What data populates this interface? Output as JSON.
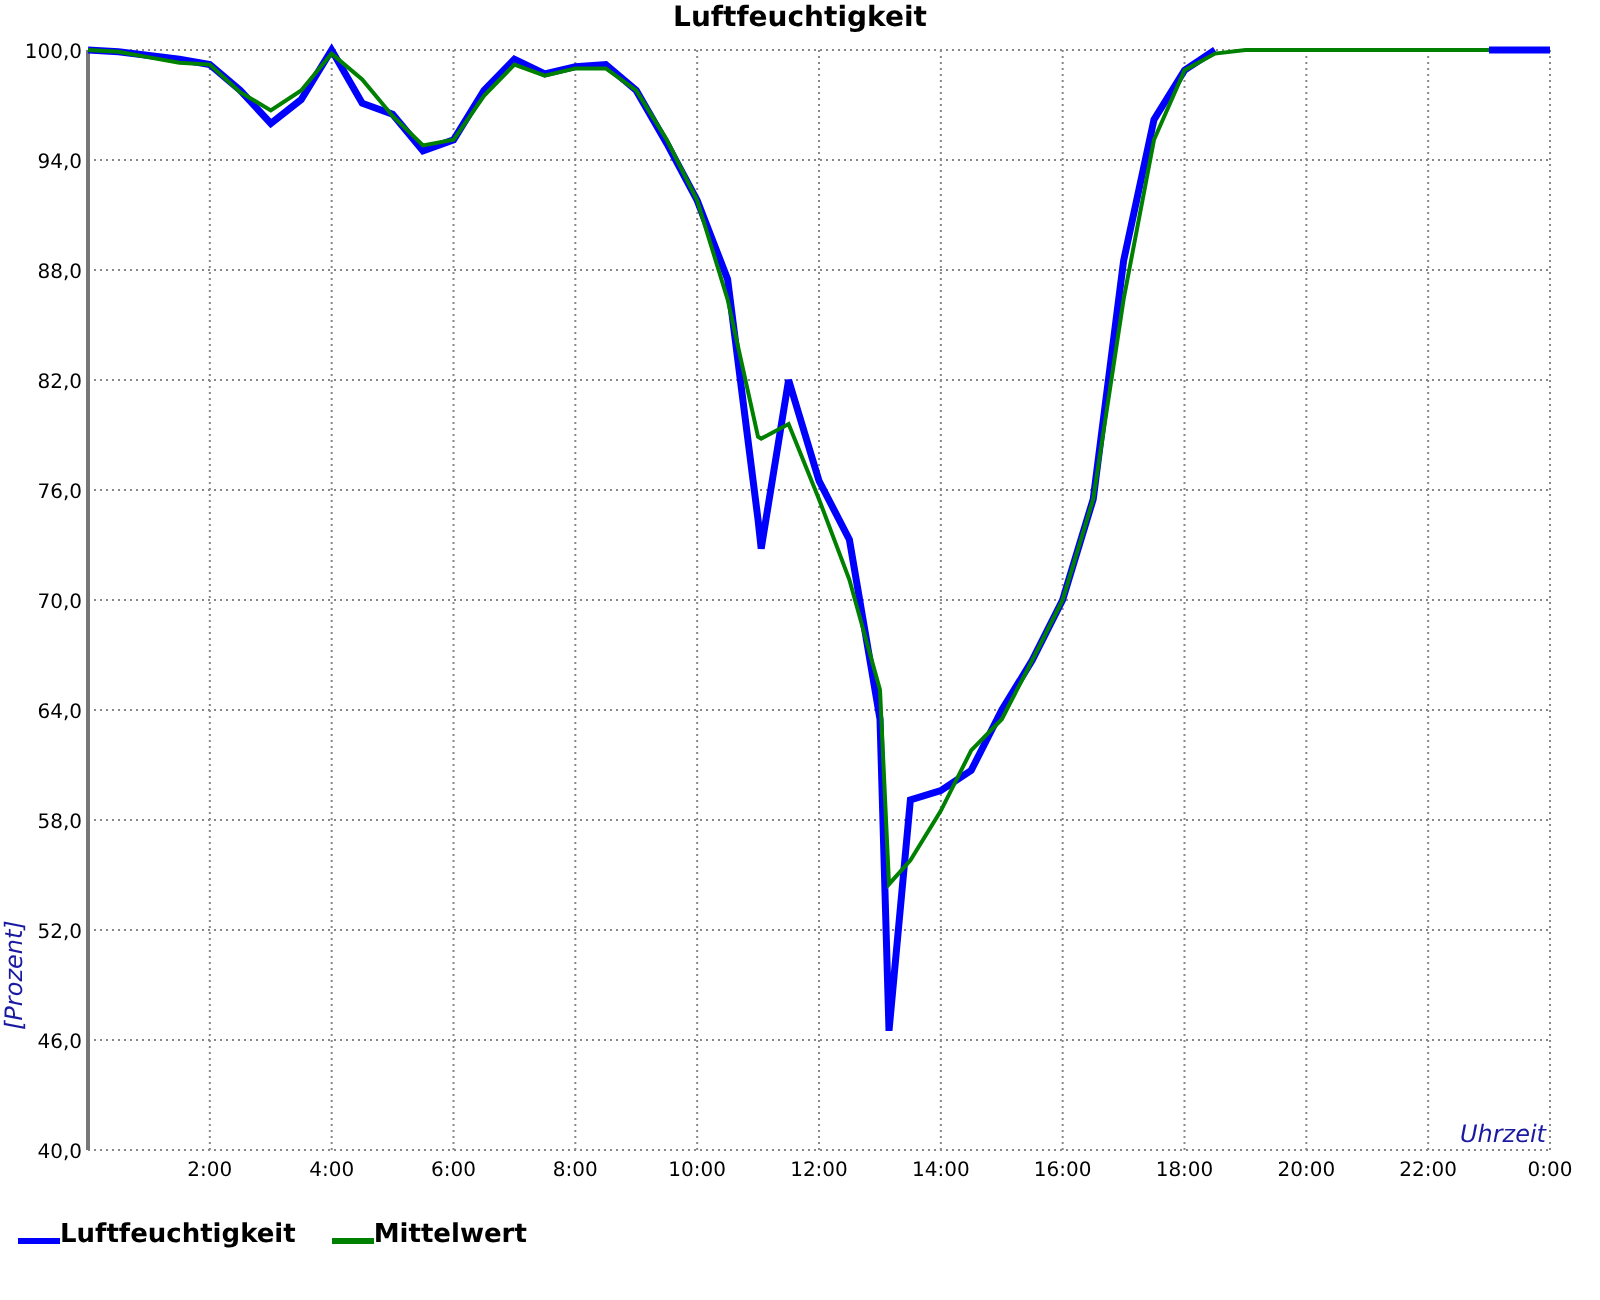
{
  "chart": {
    "chart_data": {
      "type": "line",
      "title": "Luftfeuchtigkeit",
      "xlabel": "Uhrzeit",
      "ylabel": "[Prozent]",
      "x": [
        0,
        0.5,
        1,
        1.5,
        2,
        2.5,
        3,
        3.5,
        4,
        4.5,
        5,
        5.5,
        6,
        6.5,
        7,
        7.5,
        8,
        8.5,
        9,
        9.5,
        10,
        10.5,
        11,
        11.05,
        11.5,
        12,
        12.5,
        13,
        13.15,
        13.5,
        14,
        14.5,
        15,
        15.5,
        16,
        16.5,
        17,
        17.5,
        18,
        18.5,
        19,
        20,
        21,
        22,
        23,
        24
      ],
      "series": [
        {
          "name": "Luftfeuchtigkeit",
          "color": "#0000ff",
          "values": [
            100,
            99.9,
            99.7,
            99.5,
            99.2,
            97.8,
            96.0,
            97.3,
            100,
            97.1,
            96.5,
            94.5,
            95.1,
            97.8,
            99.5,
            98.7,
            99.1,
            99.2,
            97.8,
            94.9,
            91.8,
            87.5,
            74.4,
            72.8,
            82.0,
            76.5,
            73.3,
            63.5,
            46.5,
            59.1,
            59.6,
            60.7,
            64.0,
            66.7,
            70.0,
            75.5,
            88.5,
            96.2,
            98.9,
            100,
            null,
            null,
            null,
            null,
            100,
            100
          ]
        },
        {
          "name": "Mittelwert",
          "color": "#008000",
          "values": [
            100,
            99.9,
            99.6,
            99.3,
            99.2,
            97.7,
            96.7,
            97.8,
            99.8,
            98.4,
            96.4,
            94.8,
            95.1,
            97.5,
            99.2,
            98.6,
            99.0,
            99.0,
            97.8,
            95.1,
            91.8,
            86.4,
            78.9,
            78.8,
            79.6,
            75.5,
            71.1,
            65.1,
            54.5,
            55.8,
            58.5,
            61.8,
            63.5,
            66.7,
            70.0,
            75.5,
            86.4,
            95.1,
            98.9,
            99.8,
            100,
            100,
            100,
            100,
            100,
            null
          ]
        }
      ],
      "xlim": [
        0,
        24
      ],
      "ylim": [
        40,
        100
      ],
      "grid": true,
      "xticks": [
        {
          "value": 2,
          "label": "2:00"
        },
        {
          "value": 4,
          "label": "4:00"
        },
        {
          "value": 6,
          "label": "6:00"
        },
        {
          "value": 8,
          "label": "8:00"
        },
        {
          "value": 10,
          "label": "10:00"
        },
        {
          "value": 12,
          "label": "12:00"
        },
        {
          "value": 14,
          "label": "14:00"
        },
        {
          "value": 16,
          "label": "16:00"
        },
        {
          "value": 18,
          "label": "18:00"
        },
        {
          "value": 20,
          "label": "20:00"
        },
        {
          "value": 22,
          "label": "22:00"
        },
        {
          "value": 24,
          "label": "0:00"
        }
      ],
      "yticks": [
        {
          "value": 40,
          "label": "40,0"
        },
        {
          "value": 46,
          "label": "46,0"
        },
        {
          "value": 52,
          "label": "52,0"
        },
        {
          "value": 58,
          "label": "58,0"
        },
        {
          "value": 64,
          "label": "64,0"
        },
        {
          "value": 70,
          "label": "70,0"
        },
        {
          "value": 76,
          "label": "76,0"
        },
        {
          "value": 82,
          "label": "82,0"
        },
        {
          "value": 88,
          "label": "88,0"
        },
        {
          "value": 94,
          "label": "94,0"
        },
        {
          "value": 100,
          "label": "100,0"
        }
      ]
    }
  }
}
